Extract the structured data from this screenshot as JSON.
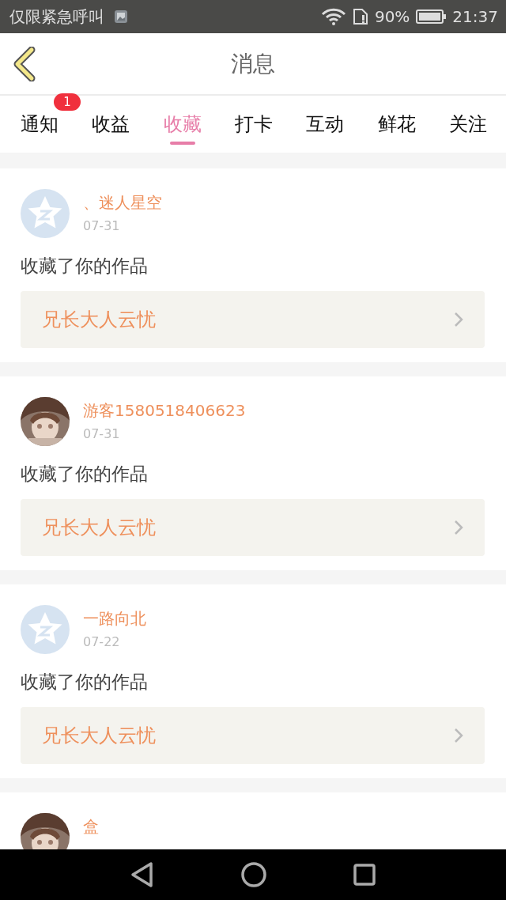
{
  "status_bar": {
    "notice": "仅限紧急呼叫",
    "battery": "90%",
    "time": "21:37"
  },
  "header": {
    "title": "消息"
  },
  "tabs": [
    {
      "label": "通知",
      "selected": false,
      "badge": "1"
    },
    {
      "label": "收益",
      "selected": false
    },
    {
      "label": "收藏",
      "selected": true
    },
    {
      "label": "打卡",
      "selected": false
    },
    {
      "label": "互动",
      "selected": false
    },
    {
      "label": "鲜花",
      "selected": false
    },
    {
      "label": "关注",
      "selected": false
    }
  ],
  "messages": [
    {
      "kind": "default",
      "name": "、迷人星空",
      "date": "07-31",
      "text": "收藏了你的作品",
      "work": "兄长大人云忧"
    },
    {
      "name": "游客1580518406623",
      "date": "07-31",
      "text": "收藏了你的作品",
      "work": "兄长大人云忧"
    },
    {
      "kind": "default",
      "name": "一路向北",
      "date": "07-22",
      "text": "收藏了你的作品",
      "work": "兄长大人云忧"
    },
    {
      "name": "盒"
    }
  ]
}
